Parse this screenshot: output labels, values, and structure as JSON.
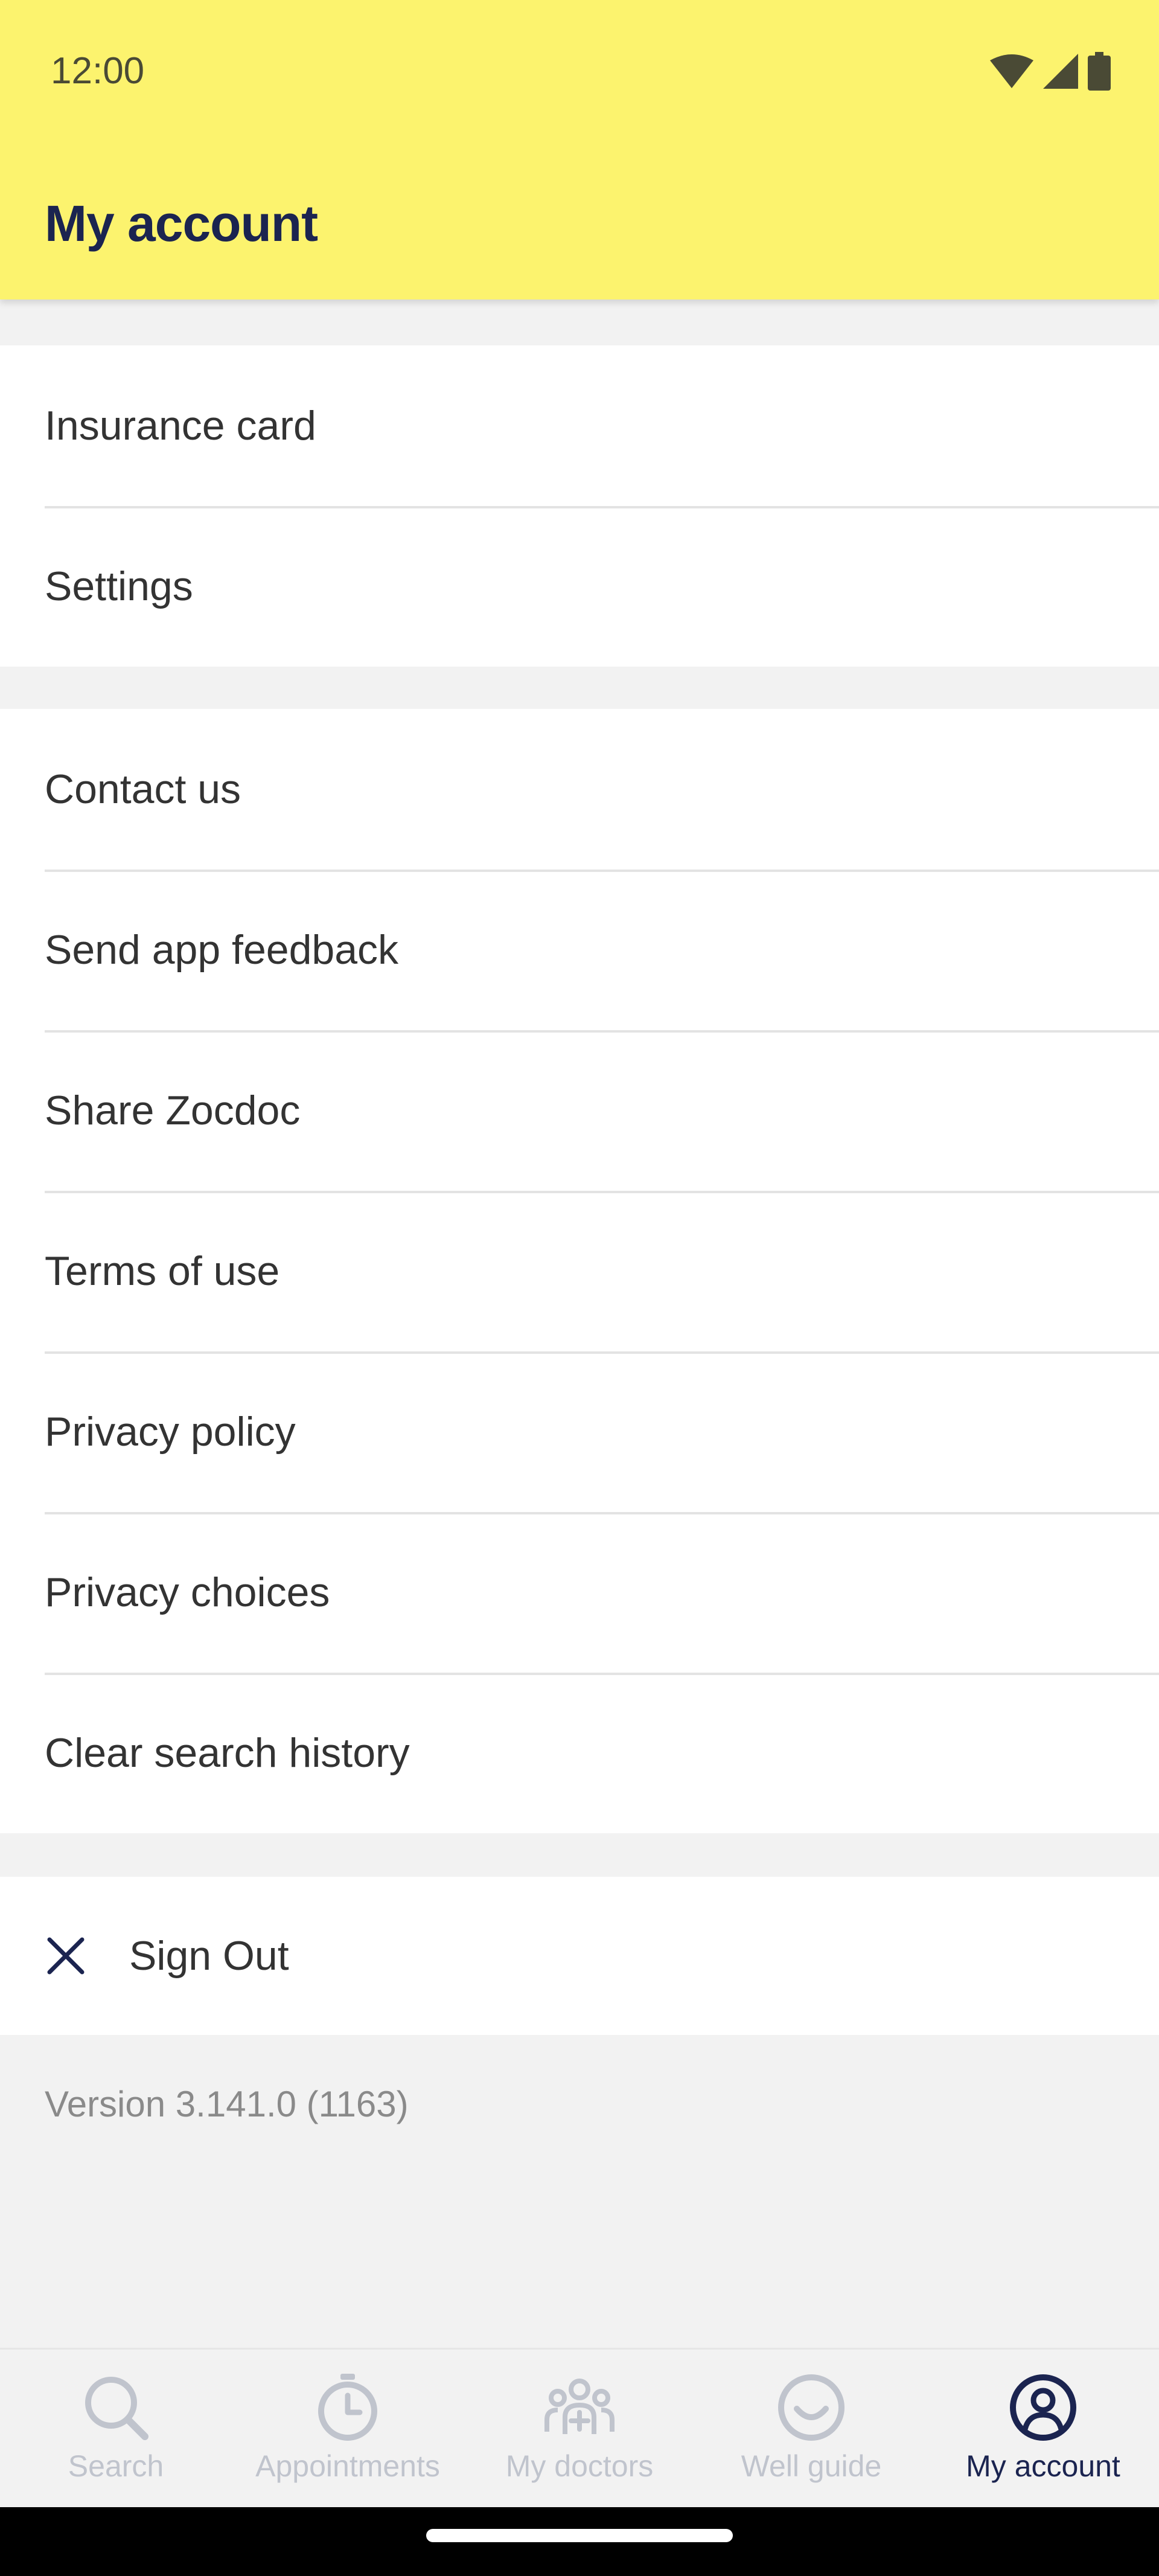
{
  "status_bar": {
    "time": "12:00",
    "icons": [
      "wifi-icon",
      "cell-signal-icon",
      "battery-icon"
    ]
  },
  "header": {
    "title": "My account",
    "background_color": "#fcf36e",
    "title_color": "#1b2450"
  },
  "section_account": {
    "items": [
      {
        "label": "Insurance card"
      },
      {
        "label": "Settings"
      }
    ]
  },
  "section_info": {
    "items": [
      {
        "label": "Contact us"
      },
      {
        "label": "Send app feedback"
      },
      {
        "label": "Share Zocdoc"
      },
      {
        "label": "Terms of use"
      },
      {
        "label": "Privacy policy"
      },
      {
        "label": "Privacy choices"
      },
      {
        "label": "Clear search history"
      }
    ]
  },
  "sign_out": {
    "label": "Sign Out",
    "icon": "close-icon"
  },
  "version_text": "Version 3.141.0 (1163)",
  "tabs": [
    {
      "label": "Search",
      "icon": "search-icon",
      "active": false
    },
    {
      "label": "Appointments",
      "icon": "clock-icon",
      "active": false
    },
    {
      "label": "My doctors",
      "icon": "doctors-group-icon",
      "active": false
    },
    {
      "label": "Well guide",
      "icon": "smile-icon",
      "active": false
    },
    {
      "label": "My account",
      "icon": "account-icon",
      "active": true
    }
  ],
  "colors": {
    "inactive_tab": "#c0c4cd",
    "active_tab": "#1b2450",
    "background": "#f2f2f2"
  }
}
